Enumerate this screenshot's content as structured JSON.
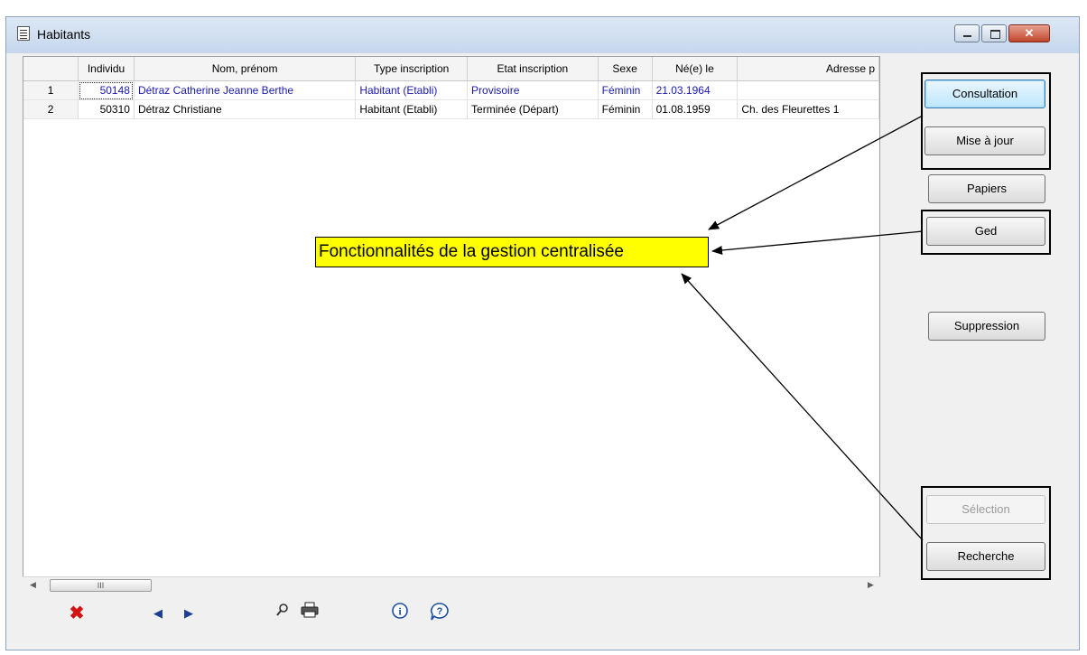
{
  "window": {
    "title": "Habitants",
    "close_symbol": "✕"
  },
  "grid": {
    "columns": [
      "",
      "Individu",
      "Nom, prénom",
      "Type inscription",
      "Etat inscription",
      "Sexe",
      "Né(e) le",
      "Adresse p"
    ],
    "rows": [
      {
        "num": "1",
        "individu": "50148",
        "nom": "Détraz Catherine Jeanne Berthe",
        "type": "Habitant (Etabli)",
        "etat": "Provisoire",
        "sexe": "Féminin",
        "ne_le": "21.03.1964",
        "adresse": ""
      },
      {
        "num": "2",
        "individu": "50310",
        "nom": "Détraz Christiane",
        "type": "Habitant (Etabli)",
        "etat": "Terminée (Départ)",
        "sexe": "Féminin",
        "ne_le": "01.08.1959",
        "adresse": "Ch. des Fleurettes 1"
      }
    ],
    "selected_row": 1
  },
  "scrollbar": {
    "thumb_grip": "III",
    "left_arrow": "◀",
    "right_arrow": "▶"
  },
  "buttons": {
    "consultation": "Consultation",
    "mise_a_jour": "Mise à jour",
    "papiers": "Papiers",
    "ged": "Ged",
    "suppression": "Suppression",
    "selection": "Sélection",
    "recherche": "Recherche"
  },
  "callout": {
    "text": "Fonctionnalités de la gestion centralisée",
    "color": "#ffff00"
  },
  "toolbar": {
    "icons": [
      "close-red-icon",
      "previous-icon",
      "next-icon",
      "search-icon",
      "print-icon",
      "info-icon",
      "help-icon"
    ],
    "close_color": "#d21414"
  }
}
